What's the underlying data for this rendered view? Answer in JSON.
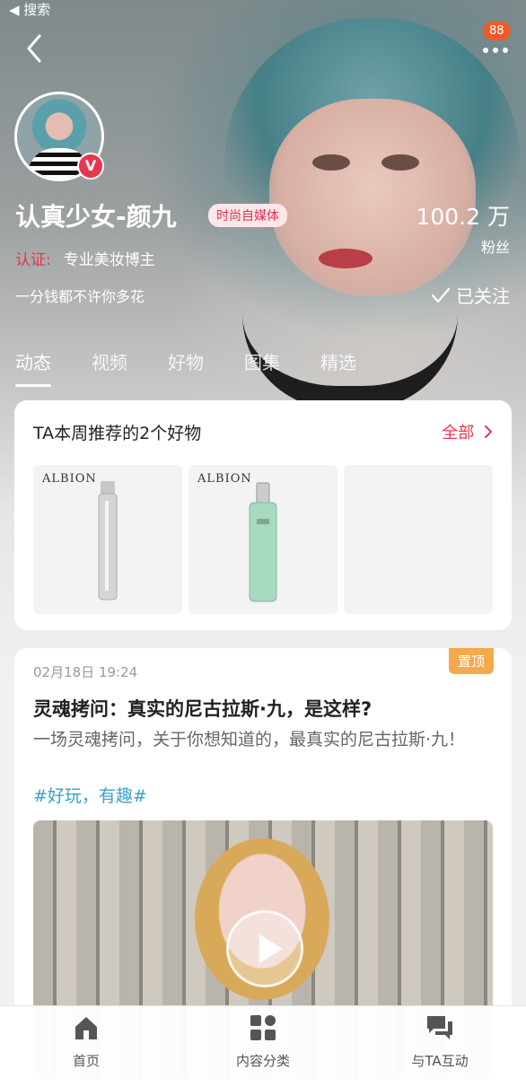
{
  "status_bar": {
    "back_label": "◀ 搜索"
  },
  "header": {
    "notification_count": "88"
  },
  "profile": {
    "name": "认真少女-颜九",
    "category_tag": "时尚自媒体",
    "verified_badge": "V",
    "fans_count": "100.2 万",
    "fans_label": "粉丝",
    "cert_label": "认证:",
    "cert_text": "专业美妆博主",
    "motto": "一分钱都不许你多花",
    "follow_label": "已关注"
  },
  "tabs": [
    "动态",
    "视频",
    "好物",
    "图集",
    "精选"
  ],
  "goods": {
    "title": "TA本周推荐的2个好物",
    "all_label": "全部",
    "products": [
      {
        "brand": "ALBION"
      },
      {
        "brand": "ALBION"
      }
    ]
  },
  "post": {
    "date": "02月18日 19:24",
    "pin_label": "置顶",
    "title": "灵魂拷问：真实的尼古拉斯·九，是这样?",
    "desc": "一场灵魂拷问，关于你想知道的，最真实的尼古拉斯·九！",
    "hashtag": "#好玩，有趣#"
  },
  "bottom_nav": [
    {
      "label": "首页",
      "icon": "home-icon"
    },
    {
      "label": "内容分类",
      "icon": "grid-icon"
    },
    {
      "label": "与TA互动",
      "icon": "chat-icon"
    }
  ]
}
